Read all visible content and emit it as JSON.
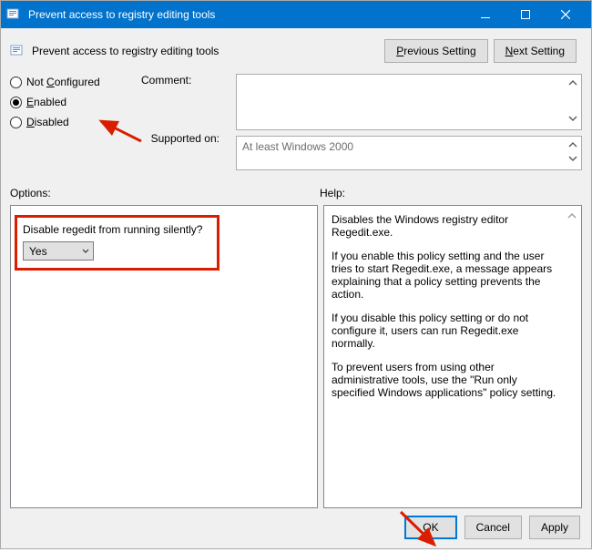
{
  "titlebar": {
    "title": "Prevent access to registry editing tools"
  },
  "header": {
    "title": "Prevent access to registry editing tools"
  },
  "nav": {
    "previous_html": "<span class='u'>P</span>revious Setting",
    "next_html": "<span class='u'>N</span>ext Setting"
  },
  "radios": {
    "not_configured_html": "Not <span class='u'>C</span>onfigured",
    "enabled_html": "<span class='u'>E</span>nabled",
    "disabled_html": "<span class='u'>D</span>isabled",
    "selected": "enabled"
  },
  "labels": {
    "comment": "Comment:",
    "supported": "Supported on:",
    "options": "Options:",
    "help": "Help:"
  },
  "fields": {
    "comment_value": "",
    "supported_value": "At least Windows 2000"
  },
  "options": {
    "question": "Disable regedit from running silently?",
    "selected": "Yes"
  },
  "help": {
    "p1": "Disables the Windows registry editor Regedit.exe.",
    "p2": "If you enable this policy setting and the user tries to start Regedit.exe, a message appears explaining that a policy setting prevents the action.",
    "p3": "If you disable this policy setting or do not configure it, users can run Regedit.exe normally.",
    "p4": "To prevent users from using other administrative tools, use the \"Run only specified Windows applications\" policy setting."
  },
  "footer": {
    "ok": "OK",
    "cancel": "Cancel",
    "apply": "Apply"
  },
  "colors": {
    "accent": "#0173cc",
    "highlight_red": "#d91e00"
  }
}
